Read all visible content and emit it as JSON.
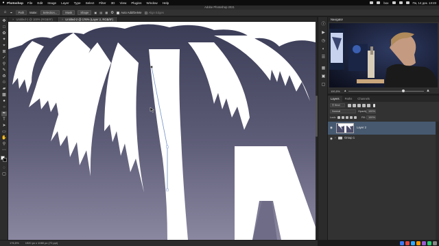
{
  "menubar": {
    "app": "Photoshop",
    "items": [
      "File",
      "Edit",
      "Image",
      "Layer",
      "Type",
      "Select",
      "Filter",
      "3D",
      "View",
      "Plugins",
      "Window",
      "Help"
    ],
    "status_right": "box",
    "clock": "Пн, 14 дек.  13:23"
  },
  "window": {
    "title": "Adobe Photoshop 2021"
  },
  "options": {
    "mode": "Path",
    "make": "Make:",
    "selection_btn": "Selection...",
    "mask_btn": "Mask",
    "shape_btn": "Shape",
    "auto_add_delete": "Auto Add/Delete",
    "align_edges": "Align Edges"
  },
  "tabs": [
    {
      "label": "Untitled-1 @ 100% (RGB/8*)"
    },
    {
      "label": "Untitled-2 @ 176% (Layer 2, RGB/8*)"
    }
  ],
  "status": {
    "zoom": "176,5%",
    "doc": "1920 px x 1080 px (72 ppi)"
  },
  "navigator": {
    "title": "Navigator",
    "zoom": "100,5%"
  },
  "layers": {
    "tabs": [
      "Layers",
      "Paths",
      "Channels"
    ],
    "filter": "Kind",
    "blend_mode": "Normal",
    "opacity_label": "Opacity:",
    "opacity": "100%",
    "lock_label": "Lock:",
    "fill_label": "Fill:",
    "fill": "100%",
    "items": [
      {
        "name": "Layer 2",
        "selected": true
      },
      {
        "name": "Group 1",
        "type": "group"
      }
    ]
  },
  "colors": {
    "canvas_top": "#3a3c56",
    "canvas_bottom": "#8a87a0",
    "selection": "#46596f",
    "path_line": "#6f8fc7"
  }
}
